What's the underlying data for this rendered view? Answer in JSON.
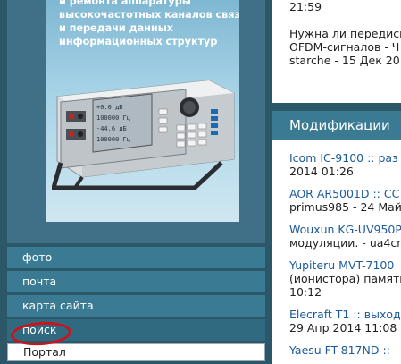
{
  "banner": {
    "lines": [
      "и ремонта аппаратуры",
      "высокочастотных каналов связи",
      "и передачи данных",
      "информационных структур"
    ],
    "screen": [
      "+0.0  дБ",
      "100000 Гц",
      "-44.6 дБ",
      "100000 Гц"
    ]
  },
  "menu": {
    "items": [
      "фото",
      "почта",
      "карта сайта",
      "поиск"
    ],
    "sub_item": "Портал",
    "annotation_color": "#d01218"
  },
  "news": {
    "lines_top": [
      "21:59"
    ],
    "item": [
      "Нужна ли передискр",
      "OFDM-сигналов - Ч",
      "starche - 15 Дек 20"
    ]
  },
  "modifications": {
    "title": "Модификации",
    "items": [
      {
        "link": "Icom IC-9100 :: раз",
        "meta": "2014 01:26"
      },
      {
        "link": "AOR AR5001D :: CC",
        "meta": "primus985 - 24 Май"
      },
      {
        "link": "Wouxun KG-UV950P",
        "meta": "модуляции. - ua4cm"
      },
      {
        "link": "Yupiteru MVT-7100",
        "meta": "(ионистора) памяти",
        "meta2": "10:12"
      },
      {
        "link": "Elecraft T1 :: выход",
        "meta": "29 Апр 2014 11:08"
      },
      {
        "link": "Yaesu FT-817ND :: ",
        "meta": ""
      }
    ]
  }
}
